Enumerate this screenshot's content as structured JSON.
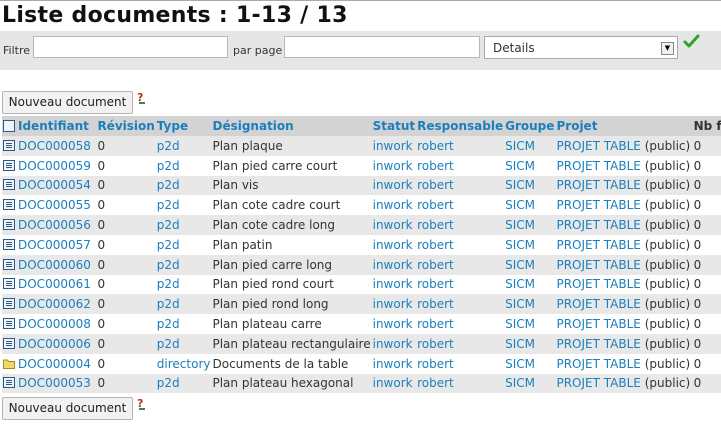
{
  "page": {
    "title": "Liste documents : 1-13 / 13"
  },
  "filters": {
    "filter_label": "Filtre",
    "filter_value": "",
    "per_page_label": "par page",
    "per_page_value": "",
    "view_select_value": "Details",
    "ok_icon": "green-checkmark-icon"
  },
  "actions": {
    "new_document_label": "Nouveau document",
    "help_icon": "question-mark-icon"
  },
  "table": {
    "headers": {
      "select_all_icon": "select-all-icon",
      "identifiant": "Identifiant",
      "revision": "Révision",
      "type": "Type",
      "designation": "Désignation",
      "statut": "Statut",
      "responsable": "Responsable",
      "groupe": "Groupe",
      "projet": "Projet",
      "nb_fichiers": "Nb fich"
    },
    "rows": [
      {
        "icon": "document-icon",
        "id": "DOC000058",
        "rev": "0",
        "type": "p2d",
        "designation": "Plan plaque",
        "statut": "inwork",
        "responsable": "robert",
        "groupe": "SICM",
        "projet": "PROJET TABLE",
        "visibility": "(public)",
        "nb": "0"
      },
      {
        "icon": "document-icon",
        "id": "DOC000059",
        "rev": "0",
        "type": "p2d",
        "designation": "Plan pied carre court",
        "statut": "inwork",
        "responsable": "robert",
        "groupe": "SICM",
        "projet": "PROJET TABLE",
        "visibility": "(public)",
        "nb": "0"
      },
      {
        "icon": "document-icon",
        "id": "DOC000054",
        "rev": "0",
        "type": "p2d",
        "designation": "Plan vis",
        "statut": "inwork",
        "responsable": "robert",
        "groupe": "SICM",
        "projet": "PROJET TABLE",
        "visibility": "(public)",
        "nb": "0"
      },
      {
        "icon": "document-icon",
        "id": "DOC000055",
        "rev": "0",
        "type": "p2d",
        "designation": "Plan cote cadre court",
        "statut": "inwork",
        "responsable": "robert",
        "groupe": "SICM",
        "projet": "PROJET TABLE",
        "visibility": "(public)",
        "nb": "0"
      },
      {
        "icon": "document-icon",
        "id": "DOC000056",
        "rev": "0",
        "type": "p2d",
        "designation": "Plan cote cadre long",
        "statut": "inwork",
        "responsable": "robert",
        "groupe": "SICM",
        "projet": "PROJET TABLE",
        "visibility": "(public)",
        "nb": "0"
      },
      {
        "icon": "document-icon",
        "id": "DOC000057",
        "rev": "0",
        "type": "p2d",
        "designation": "Plan patin",
        "statut": "inwork",
        "responsable": "robert",
        "groupe": "SICM",
        "projet": "PROJET TABLE",
        "visibility": "(public)",
        "nb": "0"
      },
      {
        "icon": "document-icon",
        "id": "DOC000060",
        "rev": "0",
        "type": "p2d",
        "designation": "Plan pied carre long",
        "statut": "inwork",
        "responsable": "robert",
        "groupe": "SICM",
        "projet": "PROJET TABLE",
        "visibility": "(public)",
        "nb": "0"
      },
      {
        "icon": "document-icon",
        "id": "DOC000061",
        "rev": "0",
        "type": "p2d",
        "designation": "Plan pied rond court",
        "statut": "inwork",
        "responsable": "robert",
        "groupe": "SICM",
        "projet": "PROJET TABLE",
        "visibility": "(public)",
        "nb": "0"
      },
      {
        "icon": "document-icon",
        "id": "DOC000062",
        "rev": "0",
        "type": "p2d",
        "designation": "Plan pied rond long",
        "statut": "inwork",
        "responsable": "robert",
        "groupe": "SICM",
        "projet": "PROJET TABLE",
        "visibility": "(public)",
        "nb": "0"
      },
      {
        "icon": "document-icon",
        "id": "DOC000008",
        "rev": "0",
        "type": "p2d",
        "designation": "Plan plateau carre",
        "statut": "inwork",
        "responsable": "robert",
        "groupe": "SICM",
        "projet": "PROJET TABLE",
        "visibility": "(public)",
        "nb": "0"
      },
      {
        "icon": "document-icon",
        "id": "DOC000006",
        "rev": "0",
        "type": "p2d",
        "designation": "Plan plateau rectangulaire",
        "statut": "inwork",
        "responsable": "robert",
        "groupe": "SICM",
        "projet": "PROJET TABLE",
        "visibility": "(public)",
        "nb": "0"
      },
      {
        "icon": "folder-icon",
        "id": "DOC000004",
        "rev": "0",
        "type": "directory",
        "designation": "Documents de la table",
        "statut": "inwork",
        "responsable": "robert",
        "groupe": "SICM",
        "projet": "PROJET TABLE",
        "visibility": "(public)",
        "nb": "0"
      },
      {
        "icon": "document-icon",
        "id": "DOC000053",
        "rev": "0",
        "type": "p2d",
        "designation": "Plan plateau hexagonal",
        "statut": "inwork",
        "responsable": "robert",
        "groupe": "SICM",
        "projet": "PROJET TABLE",
        "visibility": "(public)",
        "nb": "0"
      }
    ]
  }
}
